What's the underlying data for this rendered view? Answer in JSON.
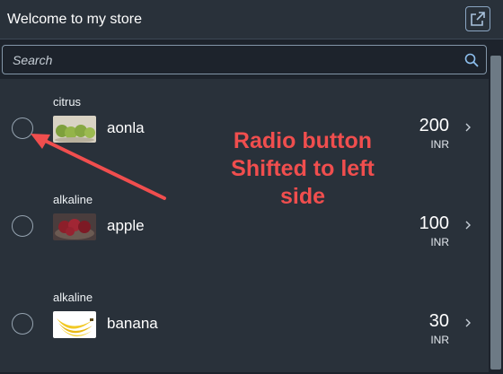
{
  "header": {
    "title": "Welcome to my store",
    "share_icon": "share-icon"
  },
  "search": {
    "placeholder": "Search",
    "icon": "search-icon"
  },
  "items": [
    {
      "category": "citrus",
      "name": "aonla",
      "price": "200",
      "currency": "INR",
      "image": "aonla-image"
    },
    {
      "category": "alkaline",
      "name": "apple",
      "price": "100",
      "currency": "INR",
      "image": "apple-image"
    },
    {
      "category": "alkaline",
      "name": "banana",
      "price": "30",
      "currency": "INR",
      "image": "banana-image"
    }
  ],
  "annotation": {
    "text_line1": "Radio button",
    "text_line2": "Shifted to left",
    "text_line3": "side",
    "color": "#f04e4e"
  },
  "colors": {
    "background": "#1d232c",
    "item_background": "#29313a",
    "accent": "#8aa5c2"
  }
}
